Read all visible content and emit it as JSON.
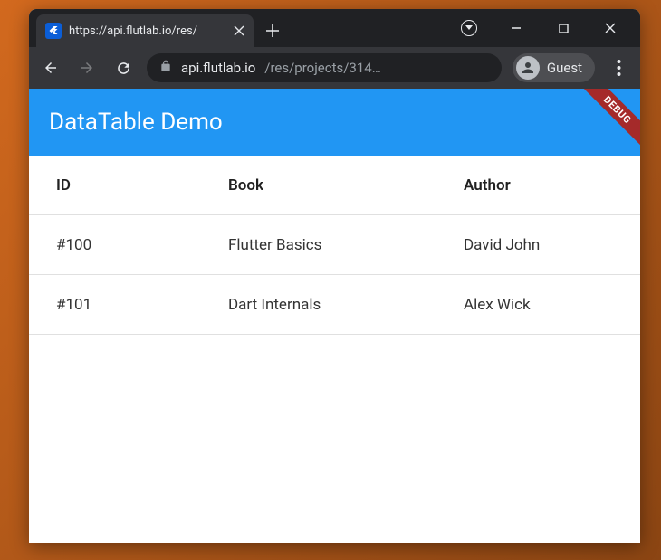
{
  "browser": {
    "tab_title": "https://api.flutlab.io/res/",
    "url_host": "api.flutlab.io",
    "url_path": "/res/projects/314…",
    "guest_label": "Guest"
  },
  "app": {
    "title": "DataTable Demo",
    "debug_label": "DEBUG"
  },
  "table": {
    "headers": {
      "id": "ID",
      "book": "Book",
      "author": "Author"
    },
    "rows": [
      {
        "id": "#100",
        "book": "Flutter Basics",
        "author": "David John"
      },
      {
        "id": "#101",
        "book": "Dart Internals",
        "author": "Alex Wick"
      }
    ]
  }
}
